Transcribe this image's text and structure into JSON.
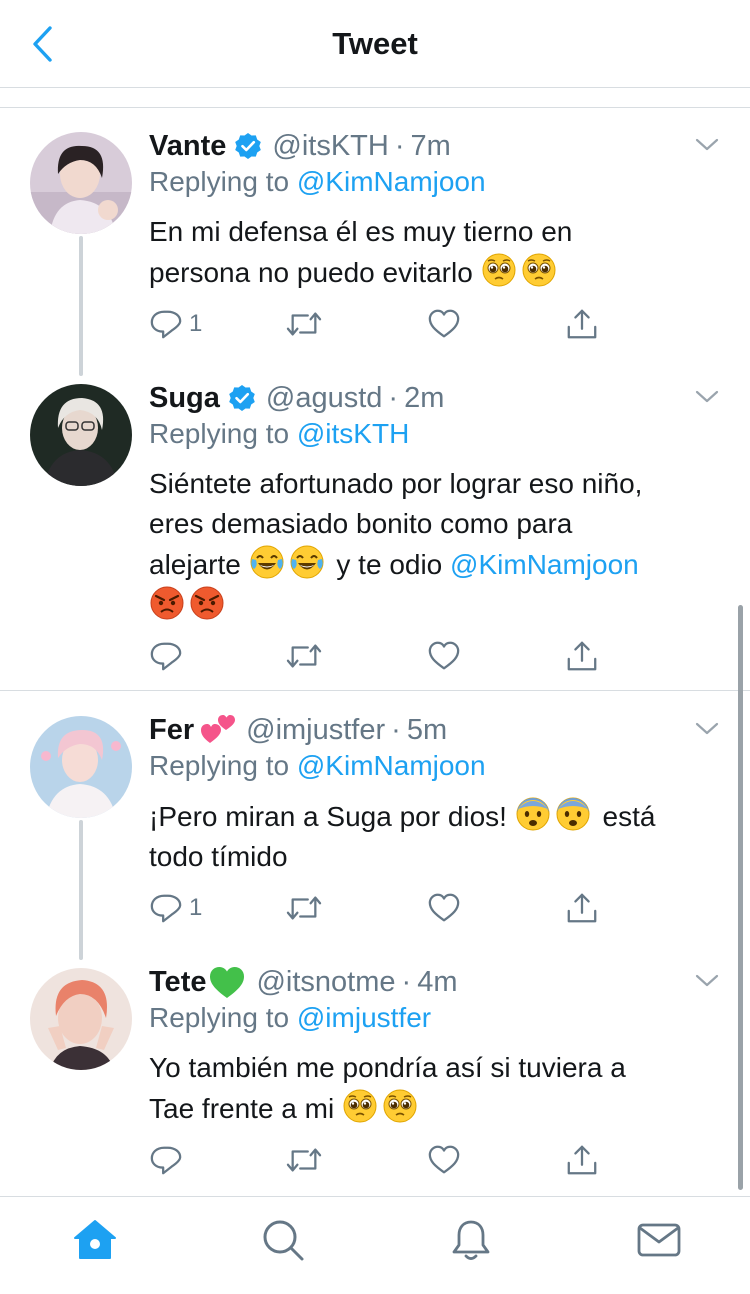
{
  "header": {
    "title": "Tweet"
  },
  "colors": {
    "link": "#1da1f2",
    "muted": "#657786",
    "text": "#14171a",
    "divider": "#d8dde1"
  },
  "tweets": [
    {
      "name": "Vante",
      "verified": true,
      "handle": "@itsKTH",
      "dot": "·",
      "time": "7m",
      "reply_prefix": "Replying to",
      "reply_to": "@KimNamjoon",
      "text_line1": "En mi defensa él es muy tierno en",
      "text_line2": "persona no puedo evitarlo",
      "emojis": [
        "pleading-face",
        "pleading-face"
      ],
      "reply_count": "1"
    },
    {
      "name": "Suga",
      "verified": true,
      "handle": "@agustd",
      "dot": "·",
      "time": "2m",
      "reply_prefix": "Replying to",
      "reply_to": "@itsKTH",
      "text_line1": "Siéntete afortunado por lograr eso niño,",
      "text_line2": "eres demasiado bonito como para",
      "text_line3a": "alejarte",
      "text_line3b": "y te odio",
      "text_mention": "@KimNamjoon",
      "emojis": [
        "tears-of-joy",
        "tears-of-joy",
        "angry-face",
        "angry-face"
      ],
      "reply_count": ""
    },
    {
      "name": "Fer",
      "name_emoji": "two-hearts",
      "handle": "@imjustfer",
      "dot": "·",
      "time": "5m",
      "reply_prefix": "Replying to",
      "reply_to": "@KimNamjoon",
      "text_line1a": "¡Pero miran a Suga por dios!",
      "text_line1b": "está",
      "text_line2": "todo tímido",
      "emojis": [
        "fearful-face",
        "fearful-face"
      ],
      "reply_count": "1"
    },
    {
      "name": "Tete",
      "name_emoji": "green-heart",
      "handle": "@itsnotme",
      "dot": "·",
      "time": "4m",
      "reply_prefix": "Replying to",
      "reply_to": "@imjustfer",
      "text_line1": "Yo también me pondría así si tuviera a",
      "text_line2": "Tae frente a mi",
      "emojis": [
        "pleading-face",
        "pleading-face"
      ],
      "reply_count": ""
    }
  ],
  "tabbar": {
    "tabs": [
      "home-icon",
      "search-icon",
      "notifications-icon",
      "messages-icon"
    ],
    "active": "home-icon"
  }
}
